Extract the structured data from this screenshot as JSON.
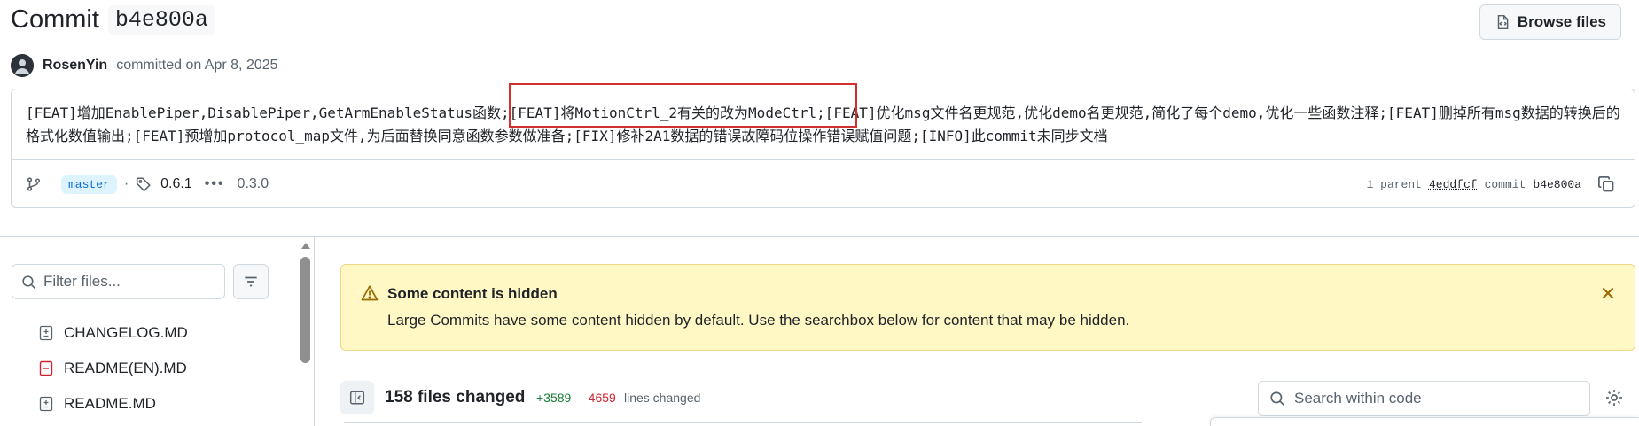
{
  "header": {
    "title_prefix": "Commit",
    "commit_sha": "b4e800a",
    "browse_files_label": "Browse files"
  },
  "author": {
    "name": "RosenYin",
    "committed_text": "committed on Apr 8, 2025"
  },
  "commit_message": {
    "before_highlight": "[FEAT]增加EnablePiper,DisablePiper,GetArmEnableStatus函数;",
    "highlighted": "[FEAT]将MotionCtrl_2有关的改为ModeCtrl;",
    "after_highlight": "[FEAT]优化msg文件名更规范,优化demo名更规范,简化了每个demo,优化一些函数注释;[FEAT]删掉所有msg数据的转换后的格式化数值输出;[FEAT]预增加protocol_map文件,为后面替换同意函数参数做准备;[FIX]修补2A1数据的错误故障码位操作错误赋值问题;[INFO]此commit未同步文档",
    "highlight_color": "#d0312d"
  },
  "commit_meta": {
    "branch": "master",
    "tag": "0.6.1",
    "tag_more": "•••",
    "tag_last": "0.3.0",
    "parent_count_text": "1 parent",
    "parent_sha": "4eddfcf",
    "commit_label": "commit",
    "commit_sha": "b4e800a"
  },
  "sidebar": {
    "filter_placeholder": "Filter files...",
    "files": [
      {
        "name": "CHANGELOG.MD",
        "status": "modified"
      },
      {
        "name": "README(EN).MD",
        "status": "deleted"
      },
      {
        "name": "README.MD",
        "status": "modified"
      }
    ]
  },
  "notice": {
    "title": "Some content is hidden",
    "body": "Large Commits have some content hidden by default. Use the searchbox below for content that may be hidden."
  },
  "files_bar": {
    "files_changed": "158 files changed",
    "additions": "+3589",
    "deletions": "-4659",
    "lines_changed": "lines changed",
    "search_placeholder": "Search within code"
  },
  "colors": {
    "added": "#1a7f37",
    "deleted": "#d1242f",
    "notice_bg": "#fff8c5",
    "branch_bg": "#ddf4ff",
    "branch_fg": "#0969da"
  }
}
